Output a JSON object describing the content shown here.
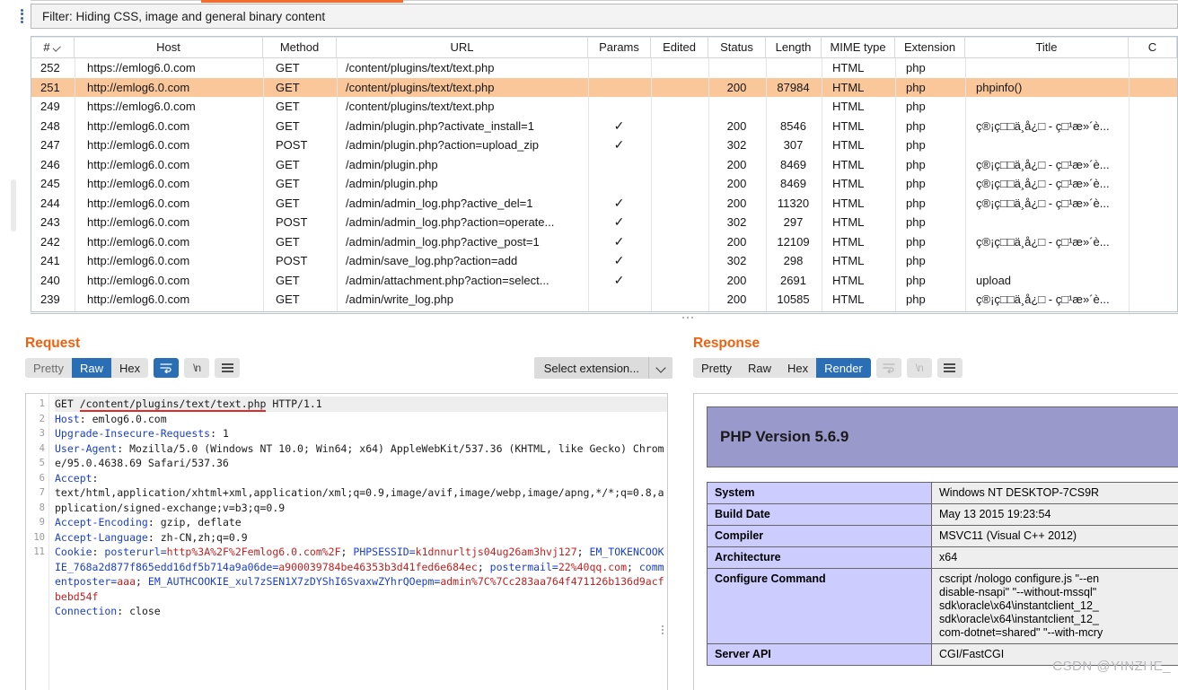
{
  "filter": {
    "text": "Filter: Hiding CSS, image and general binary content"
  },
  "table": {
    "columns": [
      {
        "key": "num",
        "label": "#",
        "sorted": true
      },
      {
        "key": "host",
        "label": "Host"
      },
      {
        "key": "method",
        "label": "Method"
      },
      {
        "key": "url",
        "label": "URL"
      },
      {
        "key": "params",
        "label": "Params"
      },
      {
        "key": "edited",
        "label": "Edited"
      },
      {
        "key": "status",
        "label": "Status"
      },
      {
        "key": "length",
        "label": "Length"
      },
      {
        "key": "mime",
        "label": "MIME type"
      },
      {
        "key": "ext",
        "label": "Extension"
      },
      {
        "key": "title",
        "label": "Title"
      },
      {
        "key": "comment",
        "label": "C"
      }
    ],
    "rows": [
      {
        "num": "252",
        "host": "https://emlog6.0.com",
        "method": "GET",
        "url": "/content/plugins/text/text.php",
        "params": "",
        "edited": "",
        "status": "",
        "length": "",
        "mime": "HTML",
        "ext": "php",
        "title": "",
        "selected": false
      },
      {
        "num": "251",
        "host": "http://emlog6.0.com",
        "method": "GET",
        "url": "/content/plugins/text/text.php",
        "params": "",
        "edited": "",
        "status": "200",
        "length": "87984",
        "mime": "HTML",
        "ext": "php",
        "title": "phpinfo()",
        "selected": true
      },
      {
        "num": "249",
        "host": "https://emlog6.0.com",
        "method": "GET",
        "url": "/content/plugins/text/text.php",
        "params": "",
        "edited": "",
        "status": "",
        "length": "",
        "mime": "HTML",
        "ext": "php",
        "title": "",
        "selected": false
      },
      {
        "num": "248",
        "host": "http://emlog6.0.com",
        "method": "GET",
        "url": "/admin/plugin.php?activate_install=1",
        "params": "✓",
        "edited": "",
        "status": "200",
        "length": "8546",
        "mime": "HTML",
        "ext": "php",
        "title": "ç®¡ç□□ä¸­å¿□ - ç□¹æ»´è...",
        "selected": false
      },
      {
        "num": "247",
        "host": "http://emlog6.0.com",
        "method": "POST",
        "url": "/admin/plugin.php?action=upload_zip",
        "params": "✓",
        "edited": "",
        "status": "302",
        "length": "307",
        "mime": "HTML",
        "ext": "php",
        "title": "",
        "selected": false
      },
      {
        "num": "246",
        "host": "http://emlog6.0.com",
        "method": "GET",
        "url": "/admin/plugin.php",
        "params": "",
        "edited": "",
        "status": "200",
        "length": "8469",
        "mime": "HTML",
        "ext": "php",
        "title": "ç®¡ç□□ä¸­å¿□ - ç□¹æ»´è...",
        "selected": false
      },
      {
        "num": "245",
        "host": "http://emlog6.0.com",
        "method": "GET",
        "url": "/admin/plugin.php",
        "params": "",
        "edited": "",
        "status": "200",
        "length": "8469",
        "mime": "HTML",
        "ext": "php",
        "title": "ç®¡ç□□ä¸­å¿□ - ç□¹æ»´è...",
        "selected": false
      },
      {
        "num": "244",
        "host": "http://emlog6.0.com",
        "method": "GET",
        "url": "/admin/admin_log.php?active_del=1",
        "params": "✓",
        "edited": "",
        "status": "200",
        "length": "11320",
        "mime": "HTML",
        "ext": "php",
        "title": "ç®¡ç□□ä¸­å¿□ - ç□¹æ»´è...",
        "selected": false
      },
      {
        "num": "243",
        "host": "http://emlog6.0.com",
        "method": "POST",
        "url": "/admin/admin_log.php?action=operate...",
        "params": "✓",
        "edited": "",
        "status": "302",
        "length": "297",
        "mime": "HTML",
        "ext": "php",
        "title": "",
        "selected": false
      },
      {
        "num": "242",
        "host": "http://emlog6.0.com",
        "method": "GET",
        "url": "/admin/admin_log.php?active_post=1",
        "params": "✓",
        "edited": "",
        "status": "200",
        "length": "12109",
        "mime": "HTML",
        "ext": "php",
        "title": "ç®¡ç□□ä¸­å¿□ - ç□¹æ»´è...",
        "selected": false
      },
      {
        "num": "241",
        "host": "http://emlog6.0.com",
        "method": "POST",
        "url": "/admin/save_log.php?action=add",
        "params": "✓",
        "edited": "",
        "status": "302",
        "length": "298",
        "mime": "HTML",
        "ext": "php",
        "title": "",
        "selected": false
      },
      {
        "num": "240",
        "host": "http://emlog6.0.com",
        "method": "GET",
        "url": "/admin/attachment.php?action=select...",
        "params": "✓",
        "edited": "",
        "status": "200",
        "length": "2691",
        "mime": "HTML",
        "ext": "php",
        "title": "upload",
        "selected": false
      },
      {
        "num": "239",
        "host": "http://emlog6.0.com",
        "method": "GET",
        "url": "/admin/write_log.php",
        "params": "",
        "edited": "",
        "status": "200",
        "length": "10585",
        "mime": "HTML",
        "ext": "php",
        "title": "ç®¡ç□□ä¸­å¿□ - ç□¹æ»´è...",
        "selected": false
      }
    ]
  },
  "request": {
    "title": "Request",
    "tabs": [
      {
        "label": "Pretty",
        "active": false,
        "dim": true
      },
      {
        "label": "Raw",
        "active": true,
        "dim": false
      },
      {
        "label": "Hex",
        "active": false,
        "dim": false
      }
    ],
    "icons": [
      "word-wrap-icon",
      "newline-icon",
      "menu-icon"
    ],
    "extension_select": {
      "label": "Select extension...",
      "chevron": "chevron-down-icon"
    },
    "line_numbers": [
      "1",
      "2",
      "3",
      "4",
      "",
      "5",
      "",
      "",
      "6",
      "7",
      "8",
      "",
      "",
      "",
      "9",
      "10",
      "11"
    ],
    "lines": [
      {
        "n": "1",
        "method": "GET",
        "path": "/content/plugins/text/text.php",
        "proto": " HTTP/1.1"
      },
      {
        "n": "2",
        "key": "Host",
        "value": " emlog6.0.com"
      },
      {
        "n": "3",
        "key": "Upgrade-Insecure-Requests",
        "value": " 1"
      },
      {
        "n": "4",
        "key": "User-Agent",
        "value": " Mozilla/5.0 (Windows NT 10.0; Win64; x64) AppleWebKit/537.36 (KHTML, like Gecko) Chrome/95.0.4638.69 Safari/537.36"
      },
      {
        "n": "5",
        "key": "Accept",
        "value": "\ntext/html,application/xhtml+xml,application/xml;q=0.9,image/avif,image/webp,image/apng,*/*;q=0.8,application/signed-exchange;v=b3;q=0.9"
      },
      {
        "n": "6",
        "key": "Accept-Encoding",
        "value": " gzip, deflate"
      },
      {
        "n": "7",
        "key": "Accept-Language",
        "value": " zh-CN,zh;q=0.9"
      },
      {
        "n": "8",
        "key": "Cookie",
        "cookie_parts": [
          {
            "name": "posterurl",
            "value": "http%3A%2F%2Femlog6.0.com%2F"
          },
          {
            "name": "PHPSESSID",
            "value": "k1dnnurltjs04ug26am3hvj127"
          },
          {
            "name": "EM_TOKENCOOKIE_768a2d877f865edd16df5b714a9a06de",
            "value": "a900039784be46353b3d41fed6e684ec"
          },
          {
            "name": "postermail",
            "value": "22%40qq.com"
          },
          {
            "name": "commentposter",
            "value": "aaa"
          },
          {
            "name": "EM_AUTHCOOKIE_xul7zSEN1X7zDYShI6SvaxwZYhrQOepm",
            "value": "admin%7C%7Cc283aa764f471126b136d9acfbebd54f"
          }
        ]
      },
      {
        "n": "9",
        "key": "Connection",
        "value": " close"
      }
    ]
  },
  "response": {
    "title": "Response",
    "tabs": [
      {
        "label": "Pretty",
        "active": false,
        "dim": false
      },
      {
        "label": "Raw",
        "active": false,
        "dim": false
      },
      {
        "label": "Hex",
        "active": false,
        "dim": false
      },
      {
        "label": "Render",
        "active": true,
        "dim": false
      }
    ],
    "icons": [
      "word-wrap-icon",
      "newline-icon",
      "menu-icon"
    ],
    "phpinfo": {
      "version_heading": "PHP Version 5.6.9",
      "rows": [
        {
          "key": "System",
          "value": "Windows NT DESKTOP-7CS9R"
        },
        {
          "key": "Build Date",
          "value": "May 13 2015 19:23:54"
        },
        {
          "key": "Compiler",
          "value": "MSVC11 (Visual C++ 2012)"
        },
        {
          "key": "Architecture",
          "value": "x64"
        },
        {
          "key": "Configure Command",
          "value": "cscript /nologo configure.js \"--en\ndisable-nsapi\" \"--without-mssql\"\nsdk\\oracle\\x64\\instantclient_12_\nsdk\\oracle\\x64\\instantclient_12_\ncom-dotnet=shared\" \"--with-mcry"
        },
        {
          "key": "Server API",
          "value": "CGI/FastCGI"
        }
      ]
    }
  },
  "watermark": "CSDN @YINZHE_",
  "colors": {
    "accent_orange": "#f0600d",
    "selected_row": "#fac79a",
    "active_tab_blue": "#2a6fb5",
    "php_banner": "#9999cc",
    "php_key_cell": "#ccccff",
    "php_value_cell": "#eeeeee"
  }
}
